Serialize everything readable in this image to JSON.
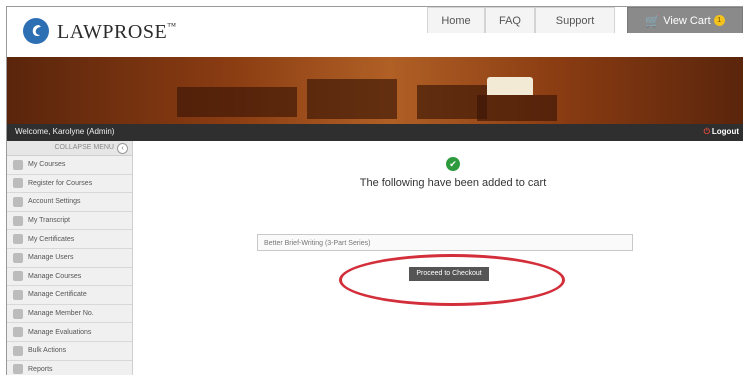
{
  "brand": {
    "name": "LAWPROSE",
    "mark": "™"
  },
  "nav": {
    "home": "Home",
    "faq": "FAQ",
    "support": "Support",
    "cart": "View Cart",
    "cart_count": "1"
  },
  "welcome_bar": {
    "welcome": "Welcome, Karolyne (Admin)",
    "logout": "Logout"
  },
  "sidebar": {
    "collapse": "COLLAPSE MENU",
    "items": [
      {
        "label": "My Courses"
      },
      {
        "label": "Register for Courses"
      },
      {
        "label": "Account Settings"
      },
      {
        "label": "My Transcript"
      },
      {
        "label": "My Certificates"
      },
      {
        "label": "Manage Users"
      },
      {
        "label": "Manage Courses"
      },
      {
        "label": "Manage Certificate"
      },
      {
        "label": "Manage Member No."
      },
      {
        "label": "Manage Evaluations"
      },
      {
        "label": "Bulk Actions"
      },
      {
        "label": "Reports"
      }
    ]
  },
  "main": {
    "heading": "The following have been added to cart",
    "item": "Better Brief-Writing (3-Part Series)",
    "checkout": "Proceed to Checkout"
  },
  "colors": {
    "accent_green": "#2e9a3e",
    "highlight_red": "#d32f3a",
    "banner_brown": "#8a3c12",
    "logo_blue": "#2d6fb3"
  }
}
